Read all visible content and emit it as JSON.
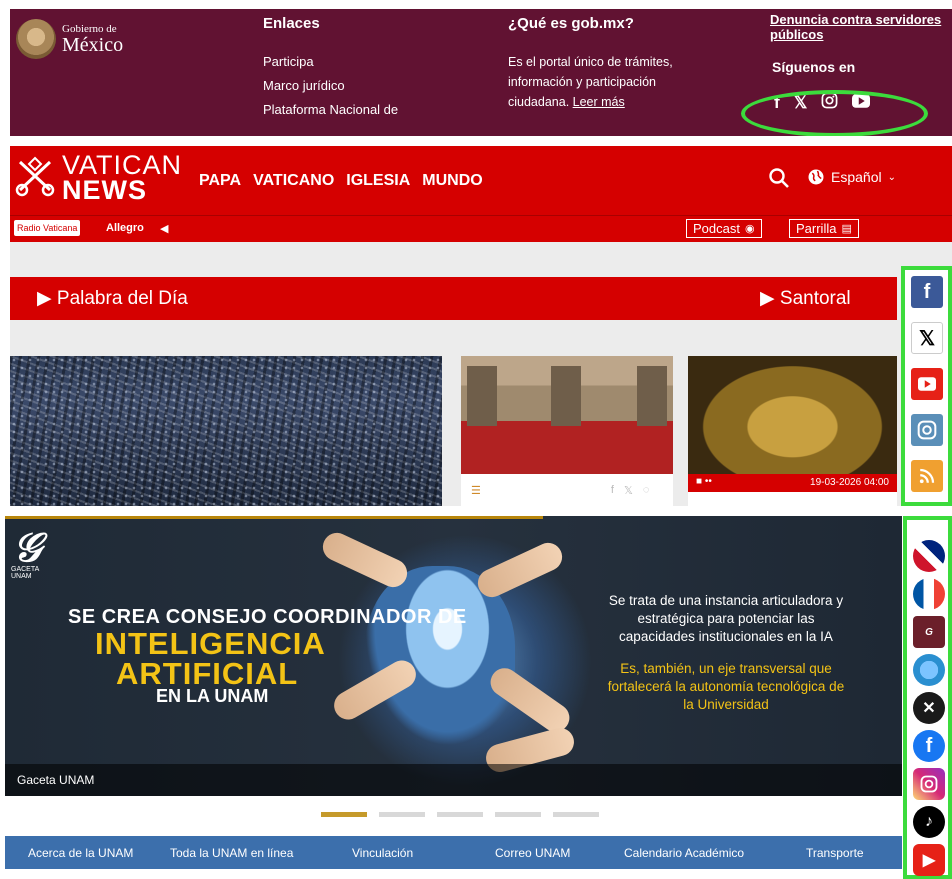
{
  "gob": {
    "logo_small": "Gobierno de",
    "logo_big": "México",
    "enlaces_title": "Enlaces",
    "links": [
      "Participa",
      "Marco jurídico",
      "Plataforma Nacional de"
    ],
    "que_title": "¿Qué es gob.mx?",
    "que_text": "Es el portal único de trámites, información y participación ciudadana.",
    "leer_mas": "Leer más",
    "denuncia": "Denuncia contra servidores públicos",
    "siguenos": "Síguenos en",
    "social_icons": [
      "facebook-icon",
      "x-icon",
      "instagram-icon",
      "youtube-icon"
    ],
    "colors": {
      "bg": "#611232",
      "highlight": "#3cdb3c"
    }
  },
  "vatican": {
    "brand_line1": "VATICAN",
    "brand_line2": "NEWS",
    "nav": [
      "PAPA",
      "VATICANO",
      "IGLESIA",
      "MUNDO"
    ],
    "language": "Español",
    "radio_label": "Radio Vaticana",
    "allegro": "Allegro",
    "podcast": "Podcast",
    "parrilla": "Parrilla",
    "palabra": "Palabra del Día",
    "santoral": "Santoral",
    "card3_date": "19-03-2026 04:00",
    "social_icons": [
      "facebook-icon",
      "x-icon",
      "youtube-icon",
      "instagram-icon",
      "rss-icon"
    ],
    "colors": {
      "red": "#d50000",
      "bg": "#ececec"
    }
  },
  "unam": {
    "logo_sub": "GACETA UNAM",
    "headline_1": "SE CREA CONSEJO COORDINADOR DE",
    "headline_2": "INTELIGENCIA",
    "headline_3": "ARTIFICIAL",
    "headline_4": "EN LA UNAM",
    "right_white": "Se trata de una instancia articuladora y estratégica para potenciar las capacidades institucionales en la IA",
    "right_yellow": "Es, también, un eje transversal que fortalecerá la autonomía tecnológica de la Universidad",
    "caption": "Gaceta UNAM",
    "nav": [
      "Acerca de la UNAM",
      "Toda la UNAM en línea",
      "Vinculación",
      "Correo UNAM",
      "Calendario Académico",
      "Transporte"
    ],
    "side_icons": [
      "uk-flag-icon",
      "france-flag-icon",
      "global-icon",
      "globe-icon",
      "x-icon",
      "facebook-icon",
      "instagram-icon",
      "tiktok-icon",
      "youtube-icon"
    ],
    "colors": {
      "nav": "#3c6fac",
      "gold": "#c59a2b",
      "yellow": "#f3c316"
    }
  }
}
